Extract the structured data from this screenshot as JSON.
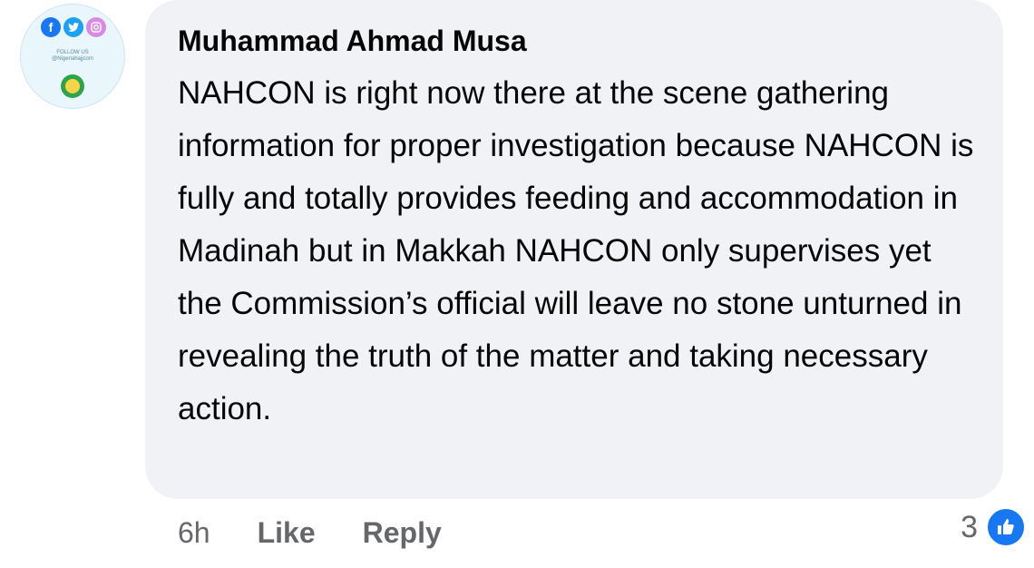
{
  "avatar": {
    "follow_text": "FOLLOW US",
    "handle": "@Nigeriahajjcom"
  },
  "comment": {
    "author": "Muhammad Ahmad Musa",
    "text": "NAHCON is right now there at the scene gathering information for proper investigation because NAHCON is fully and totally provides feeding and accommodation in Madinah but in Makkah NAHCON only supervises yet the Commission’s official will leave no stone unturned in revealing the truth of the matter and taking necessary action."
  },
  "actions": {
    "time": "6h",
    "like_label": "Like",
    "reply_label": "Reply"
  },
  "reactions": {
    "count": "3",
    "icon": "thumbs-up-icon"
  },
  "colors": {
    "bubble_bg": "#f0f2f5",
    "like_blue": "#1877f2",
    "meta_gray": "#65676b"
  }
}
